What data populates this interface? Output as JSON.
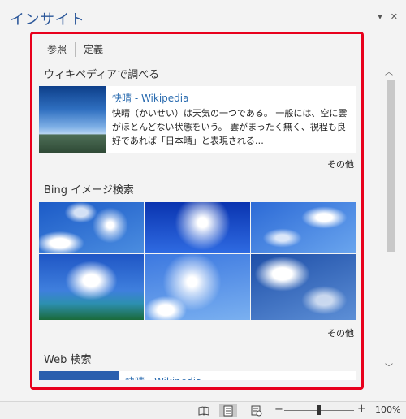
{
  "pane": {
    "title": "インサイト",
    "menu_glyph": "▾",
    "close_glyph": "✕"
  },
  "tabs": [
    {
      "label": "参照"
    },
    {
      "label": "定義"
    }
  ],
  "wikipedia": {
    "heading": "ウィキペディアで調べる",
    "title": "快晴 - Wikipedia",
    "snippet": "快晴（かいせい）は天気の一つである。 一般には、空に雲がほとんどない状態をいう。 雲がまったく無く、視程も良好であれば「日本晴」と表現される…",
    "more": "その他"
  },
  "bing": {
    "heading": "Bing イメージ検索",
    "more": "その他",
    "images": [
      {
        "desc": "blue sky with clouds"
      },
      {
        "desc": "sun in blue sky"
      },
      {
        "desc": "blue sky clouds"
      },
      {
        "desc": "sea and blue sky"
      },
      {
        "desc": "sun with lens flare"
      },
      {
        "desc": "cloudy blue sky"
      }
    ]
  },
  "web": {
    "heading": "Web 検索",
    "title": "快晴 - Wikipedia"
  },
  "scrollbar": {
    "up_glyph": "︿",
    "down_glyph": "﹀"
  },
  "statusbar": {
    "zoom_minus": "−",
    "zoom_plus": "+",
    "zoom_level": "100%"
  }
}
